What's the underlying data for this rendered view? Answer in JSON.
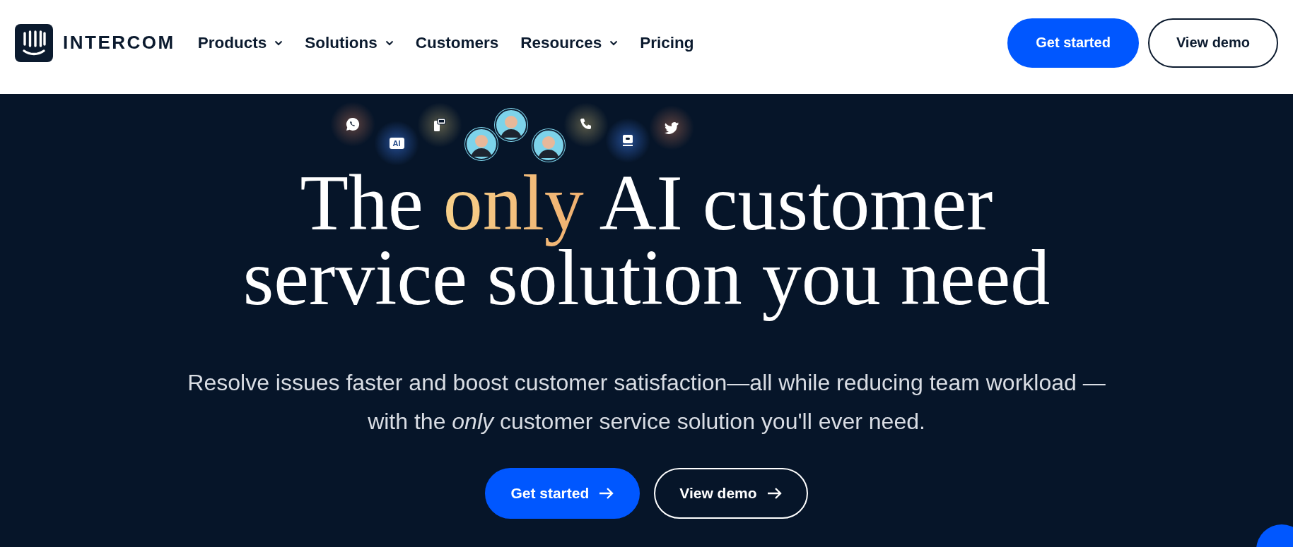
{
  "header": {
    "logo": "INTERCOM",
    "nav": [
      {
        "label": "Products",
        "dropdown": true
      },
      {
        "label": "Solutions",
        "dropdown": true
      },
      {
        "label": "Customers",
        "dropdown": false
      },
      {
        "label": "Resources",
        "dropdown": true
      },
      {
        "label": "Pricing",
        "dropdown": false
      }
    ],
    "buttons": [
      {
        "label": "Get started",
        "kind": "primary"
      },
      {
        "label": "View demo",
        "kind": "outline"
      }
    ]
  },
  "hero": {
    "floating_icons": [
      {
        "kind": "whatsapp"
      },
      {
        "kind": "ai",
        "label": "AI"
      },
      {
        "kind": "chat"
      },
      {
        "kind": "avatar"
      },
      {
        "kind": "avatar"
      },
      {
        "kind": "avatar"
      },
      {
        "kind": "phone"
      },
      {
        "kind": "monitor"
      },
      {
        "kind": "twitter"
      }
    ],
    "title_lines": [
      [
        {
          "text": "The ",
          "highlight": false
        },
        {
          "text": "only",
          "highlight": true
        },
        {
          "text": " AI customer",
          "highlight": false
        }
      ],
      [
        {
          "text": "service solution you need",
          "highlight": false
        }
      ]
    ],
    "subtitle": "Resolve issues faster and boost customer satisfaction—all while reducing team workload —with the *only* customer service solution you'll ever need.",
    "buttons": [
      {
        "label": "Get started",
        "kind": "primary"
      },
      {
        "label": "View demo",
        "kind": "outline"
      }
    ]
  }
}
